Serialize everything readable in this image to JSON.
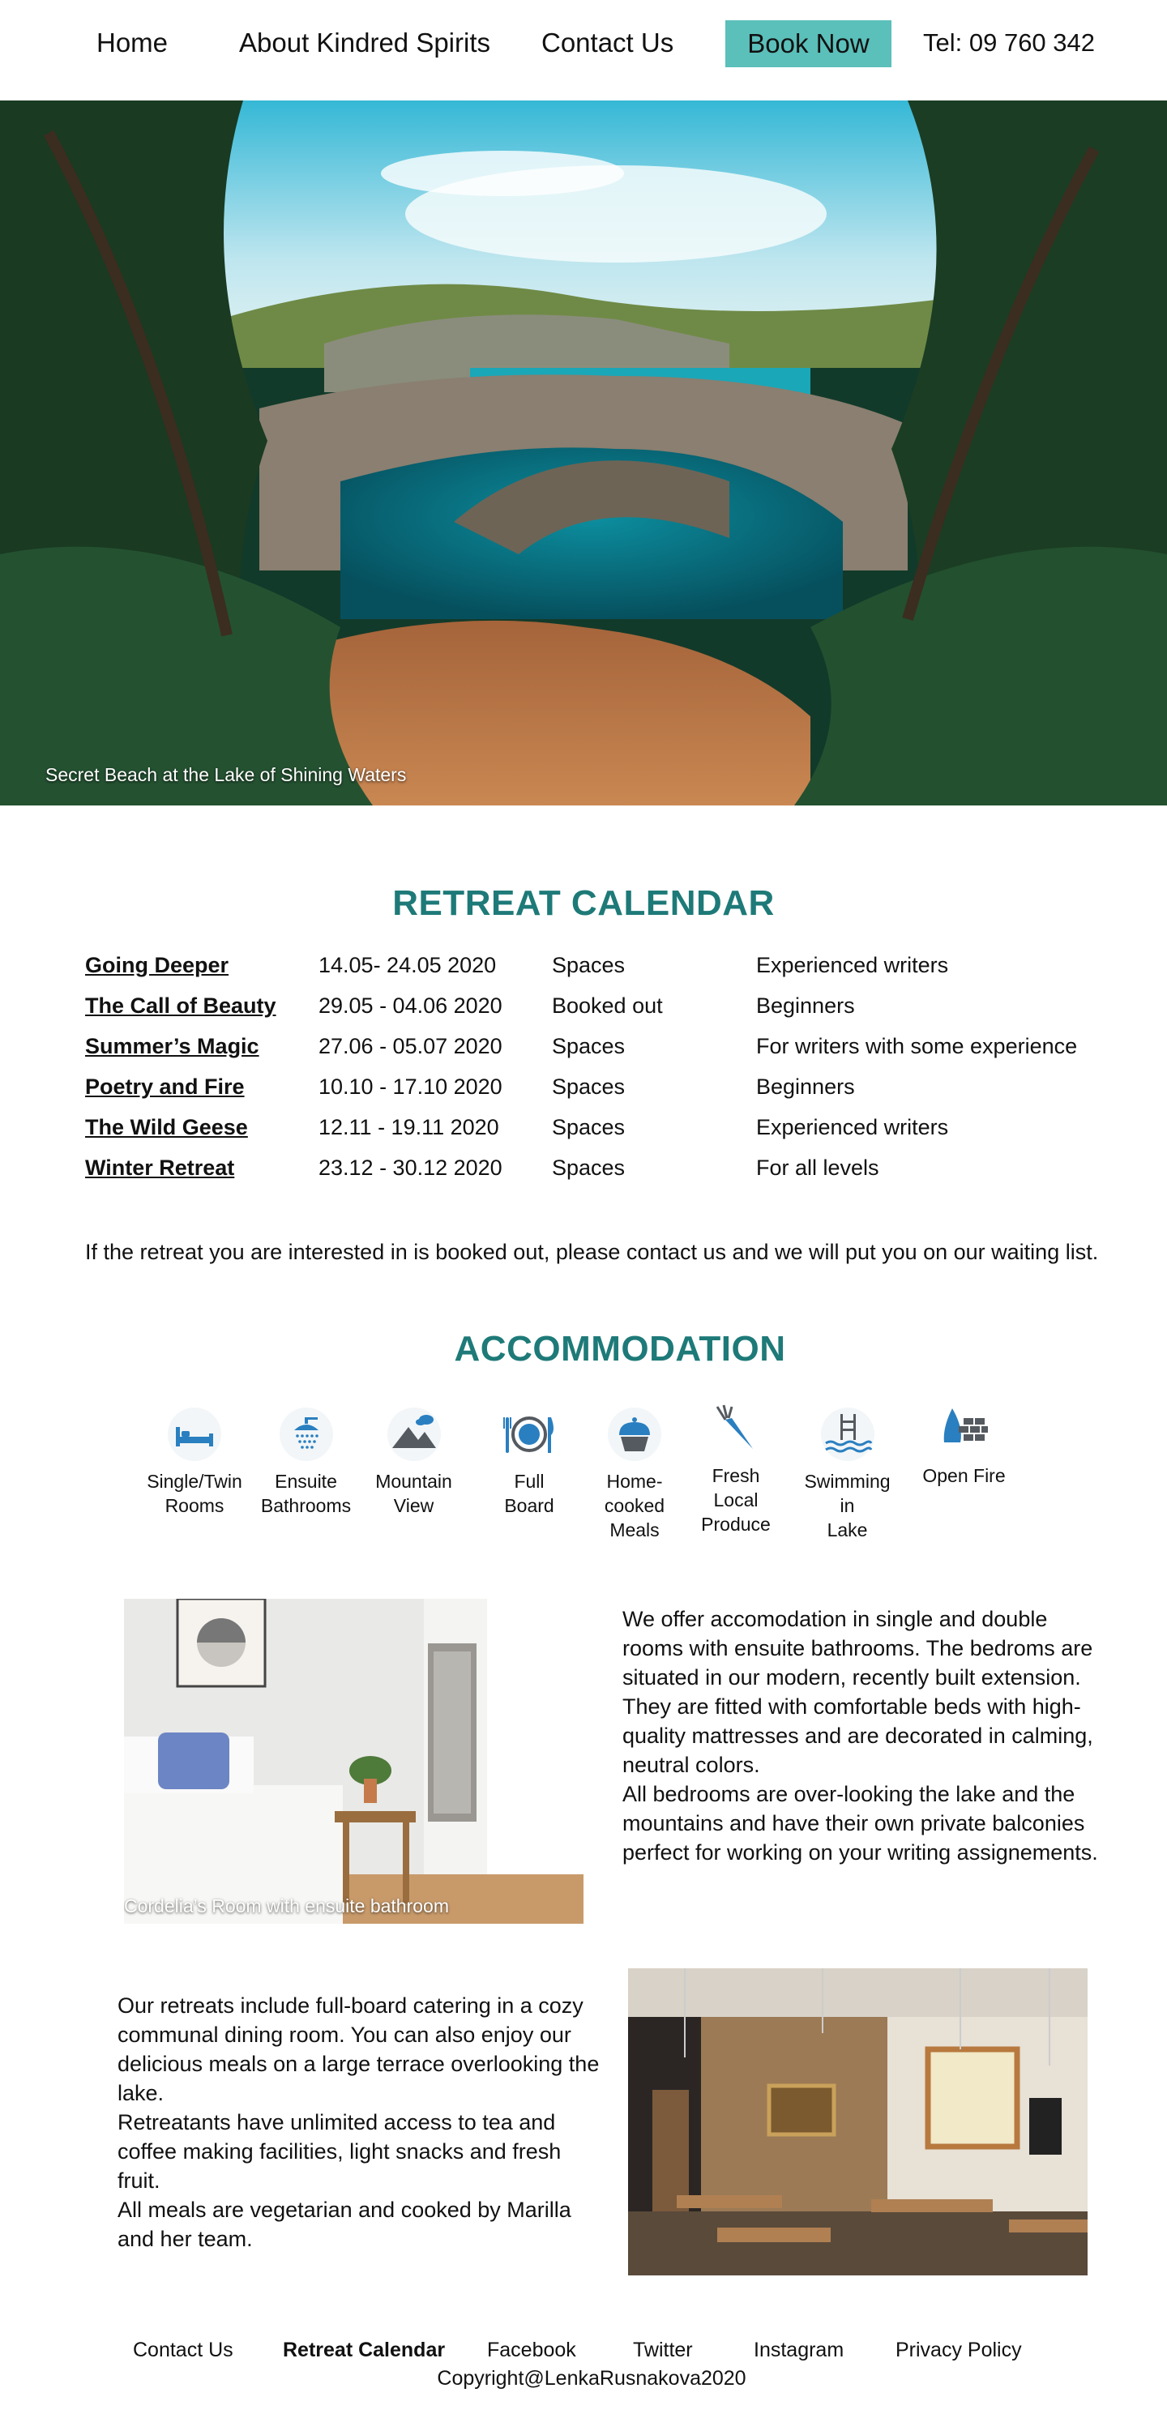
{
  "nav": {
    "home": "Home",
    "about": "About Kindred Spirits",
    "contact": "Contact Us",
    "book": "Book Now",
    "tel": "Tel: 09 760 342"
  },
  "hero": {
    "caption": "Secret Beach at the Lake of Shining Waters"
  },
  "calendar": {
    "title": "RETREAT CALENDAR",
    "rows": [
      {
        "name": "Going Deeper",
        "dates": "14.05- 24.05 2020",
        "status": "Spaces",
        "level": "Experienced writers"
      },
      {
        "name": "The Call of Beauty",
        "dates": "29.05 - 04.06 2020",
        "status": "Booked out",
        "level": "Beginners"
      },
      {
        "name": "Summer’s Magic",
        "dates": "27.06 - 05.07 2020",
        "status": "Spaces",
        "level": "For writers with some experience"
      },
      {
        "name": "Poetry and Fire",
        "dates": "10.10 - 17.10 2020",
        "status": "Spaces",
        "level": "Beginners"
      },
      {
        "name": "The Wild Geese",
        "dates": "12.11 - 19.11 2020",
        "status": "Spaces",
        "level": "Experienced writers"
      },
      {
        "name": "Winter Retreat",
        "dates": "23.12 - 30.12 2020",
        "status": "Spaces",
        "level": "For all levels"
      }
    ],
    "waiting_note": "If the retreat you are interested in is booked out, please contact us and we will put you on our waiting list."
  },
  "accommodation": {
    "title": "ACCOMMODATION",
    "amenities": [
      {
        "icon": "bed-icon",
        "lines": [
          "Single/Twin",
          "Rooms"
        ]
      },
      {
        "icon": "shower-icon",
        "lines": [
          "Ensuite",
          "Bathrooms"
        ]
      },
      {
        "icon": "mountain-icon",
        "lines": [
          "Mountain",
          "View"
        ]
      },
      {
        "icon": "plate-cutlery-icon",
        "lines": [
          "Full",
          "Board"
        ]
      },
      {
        "icon": "cupcake-icon",
        "lines": [
          "Home-",
          "cooked",
          "Meals"
        ]
      },
      {
        "icon": "carrot-icon",
        "lines": [
          "Fresh",
          "Local",
          "Produce"
        ]
      },
      {
        "icon": "pool-ladder-icon",
        "lines": [
          "Swimming",
          "in",
          "Lake"
        ]
      },
      {
        "icon": "fireplace-icon",
        "lines": [
          "Open Fire"
        ]
      }
    ],
    "room_caption": "Cordelia’s Room with ensuite bathroom",
    "room_text": [
      "We offer accomodation in single and double rooms with ensuite bathrooms. The bedroms are situated in our modern, recently built extension. They are fitted with comfortable beds with high-quality mattresses and are decorated in calming, neutral colors.",
      "All bedrooms are over-looking the lake and the mountains and have their own private balconies perfect for working on your writing assignements."
    ],
    "dining_text": [
      "Our retreats include full-board catering in a cozy communal dining room. You can also enjoy our delicious meals on a large terrace overlooking the lake.",
      "Retreatants have unlimited access to tea and coffee making facilities, light snacks and fresh fruit.",
      "All meals are vegetarian and cooked by Marilla and her team."
    ]
  },
  "footer": {
    "contact": "Contact Us",
    "calendar": "Retreat Calendar",
    "facebook": "Facebook",
    "twitter": "Twitter",
    "instagram": "Instagram",
    "privacy": "Privacy Policy",
    "copyright": "Copyright@LenkaRusnakova2020"
  },
  "colors": {
    "accent": "#1e7a78",
    "button": "#5bbfba",
    "icon_blue": "#2a7fc0"
  }
}
